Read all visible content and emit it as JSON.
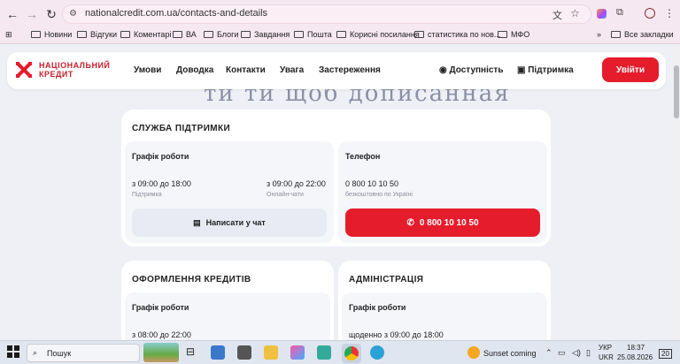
{
  "browser": {
    "url": "nationalcredit.com.ua/contacts-and-details",
    "bookmarks": [
      "Новини",
      "Відгуки",
      "Коментарі",
      "ВА",
      "Блоги",
      "Завдання",
      "Пошта",
      "Корисні посилання",
      "статистика по нов...",
      "МФО"
    ],
    "all_bookmarks": "Все закладки"
  },
  "header": {
    "logo_line1": "НАЦІОНАЛЬНИЙ",
    "logo_line2": "КРЕДИТ",
    "nav": [
      "Умови",
      "Доводка",
      "Контакти",
      "Увага",
      "Застереження"
    ],
    "accessibility": "Доступність",
    "support": "Підтримка",
    "login": "Увійти"
  },
  "page": {
    "heading_partial": "ти ти щоб дописанная",
    "support_card": {
      "title": "СЛУЖБА ПІДТРИМКИ",
      "schedule": {
        "title": "Графік роботи",
        "left_value": "з 09:00 до 18:00",
        "left_caption": "Підтримка",
        "right_value": "з 09:00 до 22:00",
        "right_caption": "Онлайн-чати",
        "chat_button": "Написати у чат"
      },
      "phone": {
        "title": "Телефон",
        "value": "0 800 10 10 50",
        "caption": "безкоштовно по Україні",
        "button": "0 800 10 10 50"
      }
    },
    "credit_card": {
      "title": "ОФОРМЛЕННЯ КРЕДИТІВ",
      "schedule_title": "Графік роботи",
      "value": "з 08:00 до 22:00"
    },
    "admin_card": {
      "title": "АДМІНІСТРАЦІЯ",
      "schedule_title": "Графік роботи",
      "value": "щоденно з 09:00 до 18:00"
    }
  },
  "taskbar": {
    "search": "Пошук",
    "weather": "Sunset coming",
    "lang1": "УКР",
    "lang2": "UKR",
    "time": "18:37",
    "date": "25.08.2026",
    "notif": "20"
  },
  "colors": {
    "brand_red": "#e51c2c",
    "bg": "#eef0f6"
  }
}
